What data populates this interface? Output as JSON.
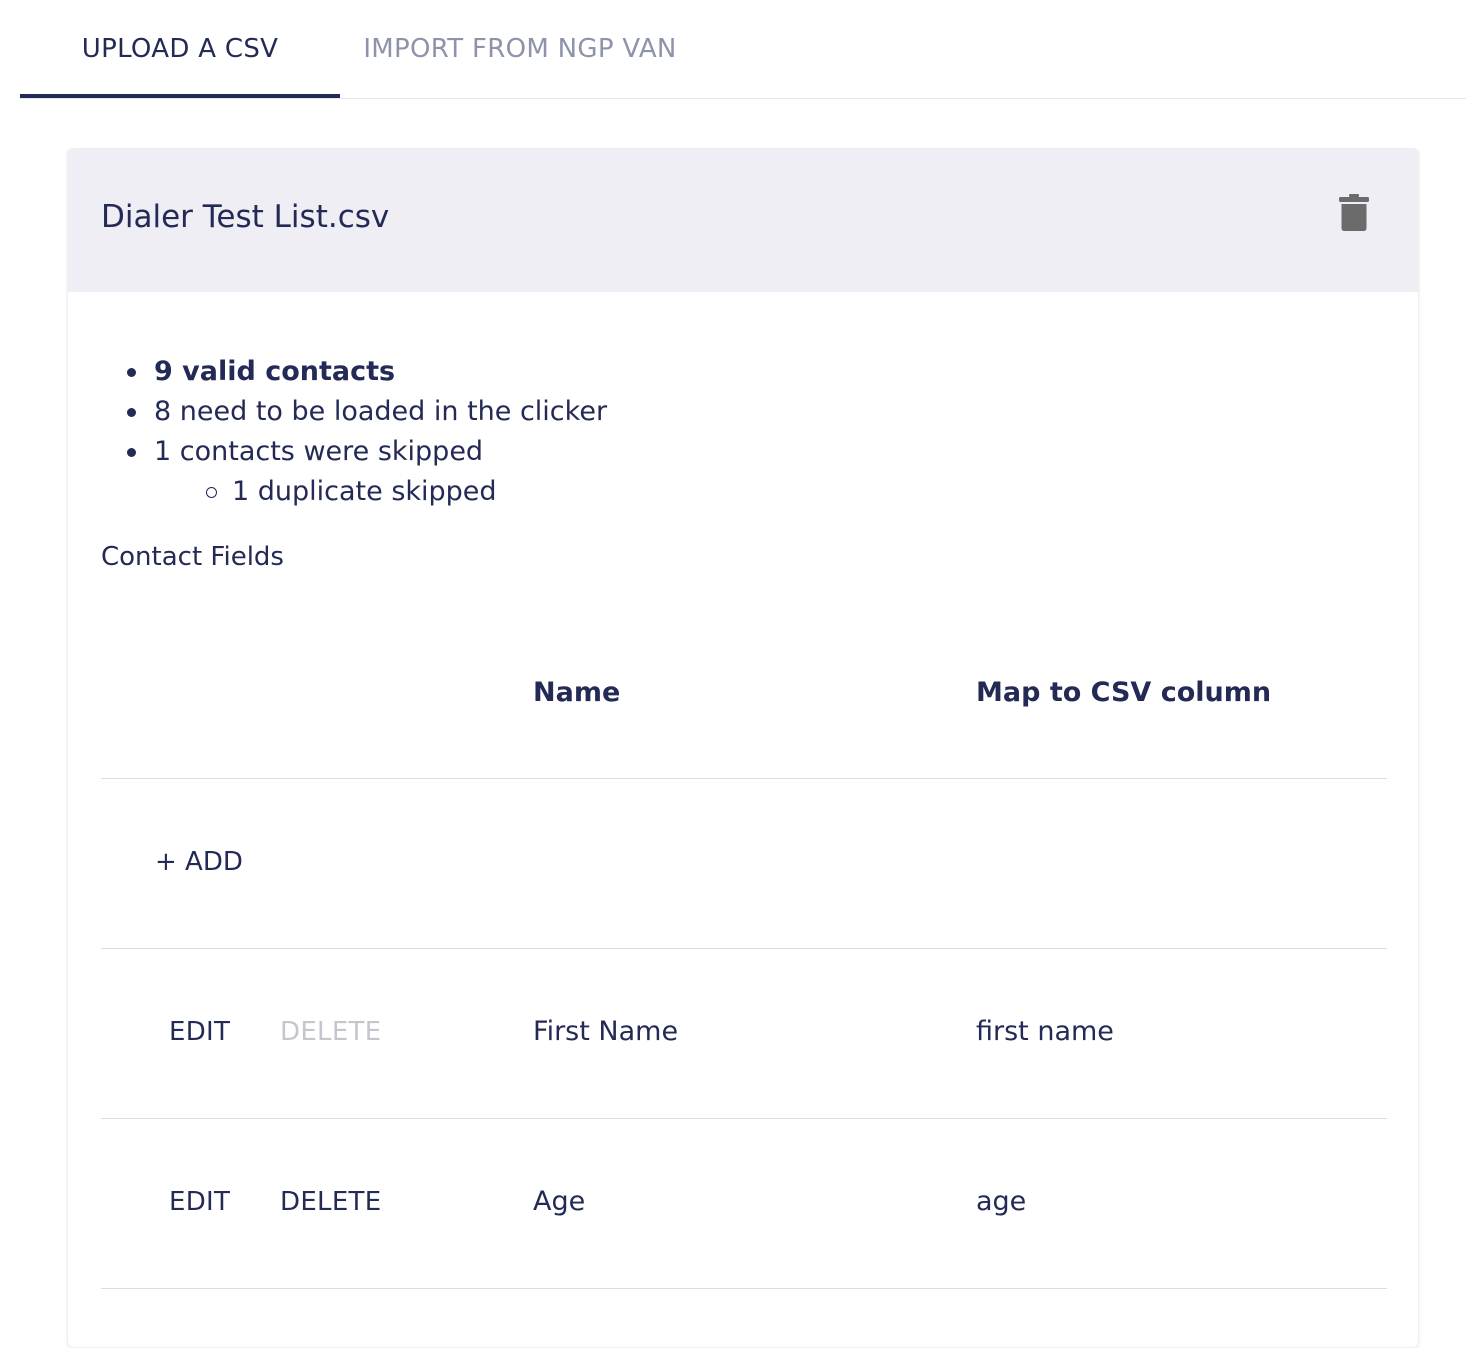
{
  "tabs": [
    {
      "label": "UPLOAD A CSV",
      "active": true
    },
    {
      "label": "IMPORT FROM NGP VAN",
      "active": false
    }
  ],
  "upload": {
    "file_name": "Dialer Test List.csv",
    "delete_icon": "trash-icon",
    "stats": {
      "valid": "9 valid contacts",
      "to_load": "8 need to be loaded in the clicker",
      "skipped": "1 contacts were skipped",
      "duplicates": "1 duplicate skipped"
    },
    "section_label": "Contact Fields"
  },
  "table": {
    "headers": {
      "name": "Name",
      "map": "Map to CSV column"
    },
    "add_label": "+ ADD",
    "rows": [
      {
        "edit": "EDIT",
        "delete": "DELETE",
        "delete_enabled": false,
        "name": "First Name",
        "map": "first name"
      },
      {
        "edit": "EDIT",
        "delete": "DELETE",
        "delete_enabled": true,
        "name": "Age",
        "map": "age"
      }
    ]
  },
  "colors": {
    "primary_text": "#232a55",
    "inactive_tab": "#8e93aa",
    "disabled_text": "#c4c6ce",
    "header_bg": "#eeeef4",
    "trash_icon": "#6b6b6b"
  }
}
